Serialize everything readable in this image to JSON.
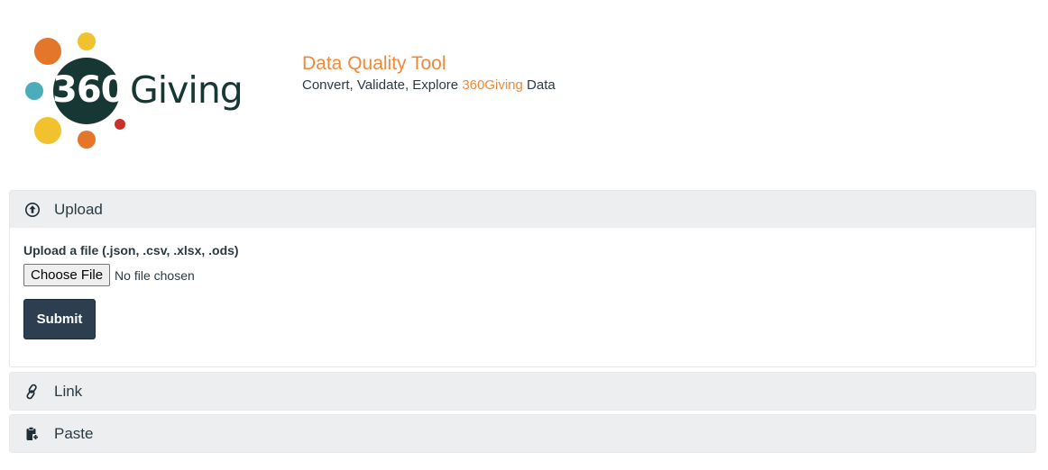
{
  "brand": {
    "logo_number": "360",
    "logo_word": "Giving",
    "colors": {
      "orange": "#e4762b",
      "yellow": "#f2c12e",
      "teal": "#4bacbb",
      "red": "#c8302a",
      "dark": "#173735"
    }
  },
  "header": {
    "title": "Data Quality Tool",
    "subtitle_prefix": "Convert, Validate, Explore ",
    "subtitle_accent": "360Giving",
    "subtitle_suffix": " Data"
  },
  "panels": [
    {
      "label": "Upload",
      "icon": "upload-circle-icon",
      "expanded": true,
      "field_label": "Upload a file (.json, .csv, .xlsx, .ods)",
      "choose_button": "Choose File",
      "file_status": "No file chosen",
      "submit_label": "Submit"
    },
    {
      "label": "Link",
      "icon": "link-icon",
      "expanded": false
    },
    {
      "label": "Paste",
      "icon": "clipboard-paste-icon",
      "expanded": false
    }
  ],
  "colors": {
    "accent": "#f0893a",
    "text": "#2b3a42",
    "panel_header_bg": "#eceeef",
    "submit_bg": "#2c3e50"
  }
}
